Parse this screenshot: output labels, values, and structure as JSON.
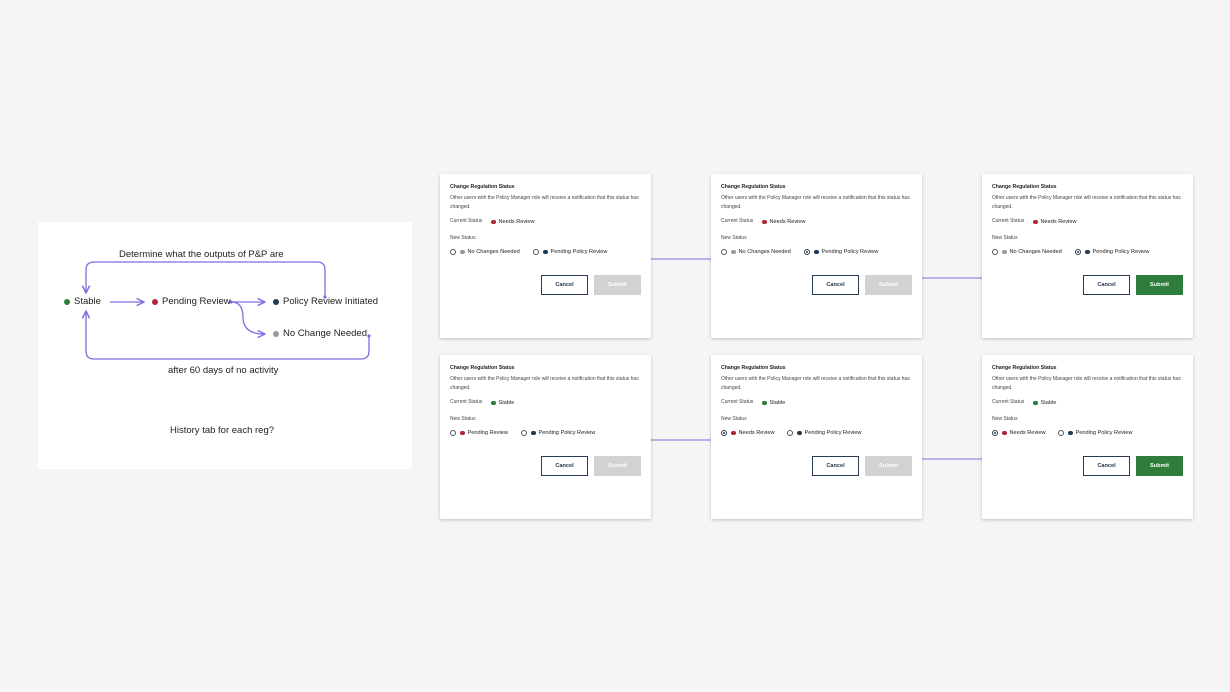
{
  "colors": {
    "arrow": "#7b6fe0",
    "stable": "#2e7d3a",
    "pending_review": "#b0253a",
    "policy_review": "#1f3b55",
    "no_change": "#9a9a9a",
    "submit_enabled": "#2e7d3a",
    "submit_disabled": "#d2d2d2"
  },
  "flow": {
    "top_label": "Determine what the outputs of P&P are",
    "bottom_label": "after 60 days of no activity",
    "note": "History tab for each reg?",
    "nodes": {
      "stable": "Stable",
      "pending_review": "Pending Review",
      "policy_review": "Policy Review Initiated",
      "no_change": "No Change Needed"
    }
  },
  "card_text": {
    "title": "Change Regulation Status",
    "description": "Other users with the Policy Manager role will receive a notification that this status has changed.",
    "current_label": "Current Status",
    "new_label": "New Status",
    "cancel": "Cancel",
    "submit": "Submit"
  },
  "cards": [
    {
      "current": "Needs Review",
      "current_color": "#b0253a",
      "options": [
        {
          "label": "No Changes Needed",
          "color": "#9a9a9a",
          "selected": false
        },
        {
          "label": "Pending Policy Review",
          "color": "#1f3b55",
          "selected": false
        }
      ],
      "submit_enabled": false
    },
    {
      "current": "Needs Review",
      "current_color": "#b0253a",
      "options": [
        {
          "label": "No Changes Needed",
          "color": "#9a9a9a",
          "selected": false
        },
        {
          "label": "Pending Policy Review",
          "color": "#1f3b55",
          "selected": true
        }
      ],
      "submit_enabled": false
    },
    {
      "current": "Needs Review",
      "current_color": "#b0253a",
      "options": [
        {
          "label": "No Changes Needed",
          "color": "#9a9a9a",
          "selected": false
        },
        {
          "label": "Pending Policy Review",
          "color": "#1f3b55",
          "selected": true
        }
      ],
      "submit_enabled": true
    },
    {
      "current": "Stable",
      "current_color": "#2e7d3a",
      "options": [
        {
          "label": "Pending Review",
          "color": "#b0253a",
          "selected": false
        },
        {
          "label": "Pending Policy Review",
          "color": "#1f3b55",
          "selected": false
        }
      ],
      "submit_enabled": false
    },
    {
      "current": "Stable",
      "current_color": "#2e7d3a",
      "options": [
        {
          "label": "Needs Review",
          "color": "#b0253a",
          "selected": true
        },
        {
          "label": "Pending Policy Review",
          "color": "#1f3b55",
          "selected": false
        }
      ],
      "submit_enabled": false
    },
    {
      "current": "Stable",
      "current_color": "#2e7d3a",
      "options": [
        {
          "label": "Needs Review",
          "color": "#b0253a",
          "selected": true
        },
        {
          "label": "Pending Policy Review",
          "color": "#1f3b55",
          "selected": false
        }
      ],
      "submit_enabled": true
    }
  ]
}
